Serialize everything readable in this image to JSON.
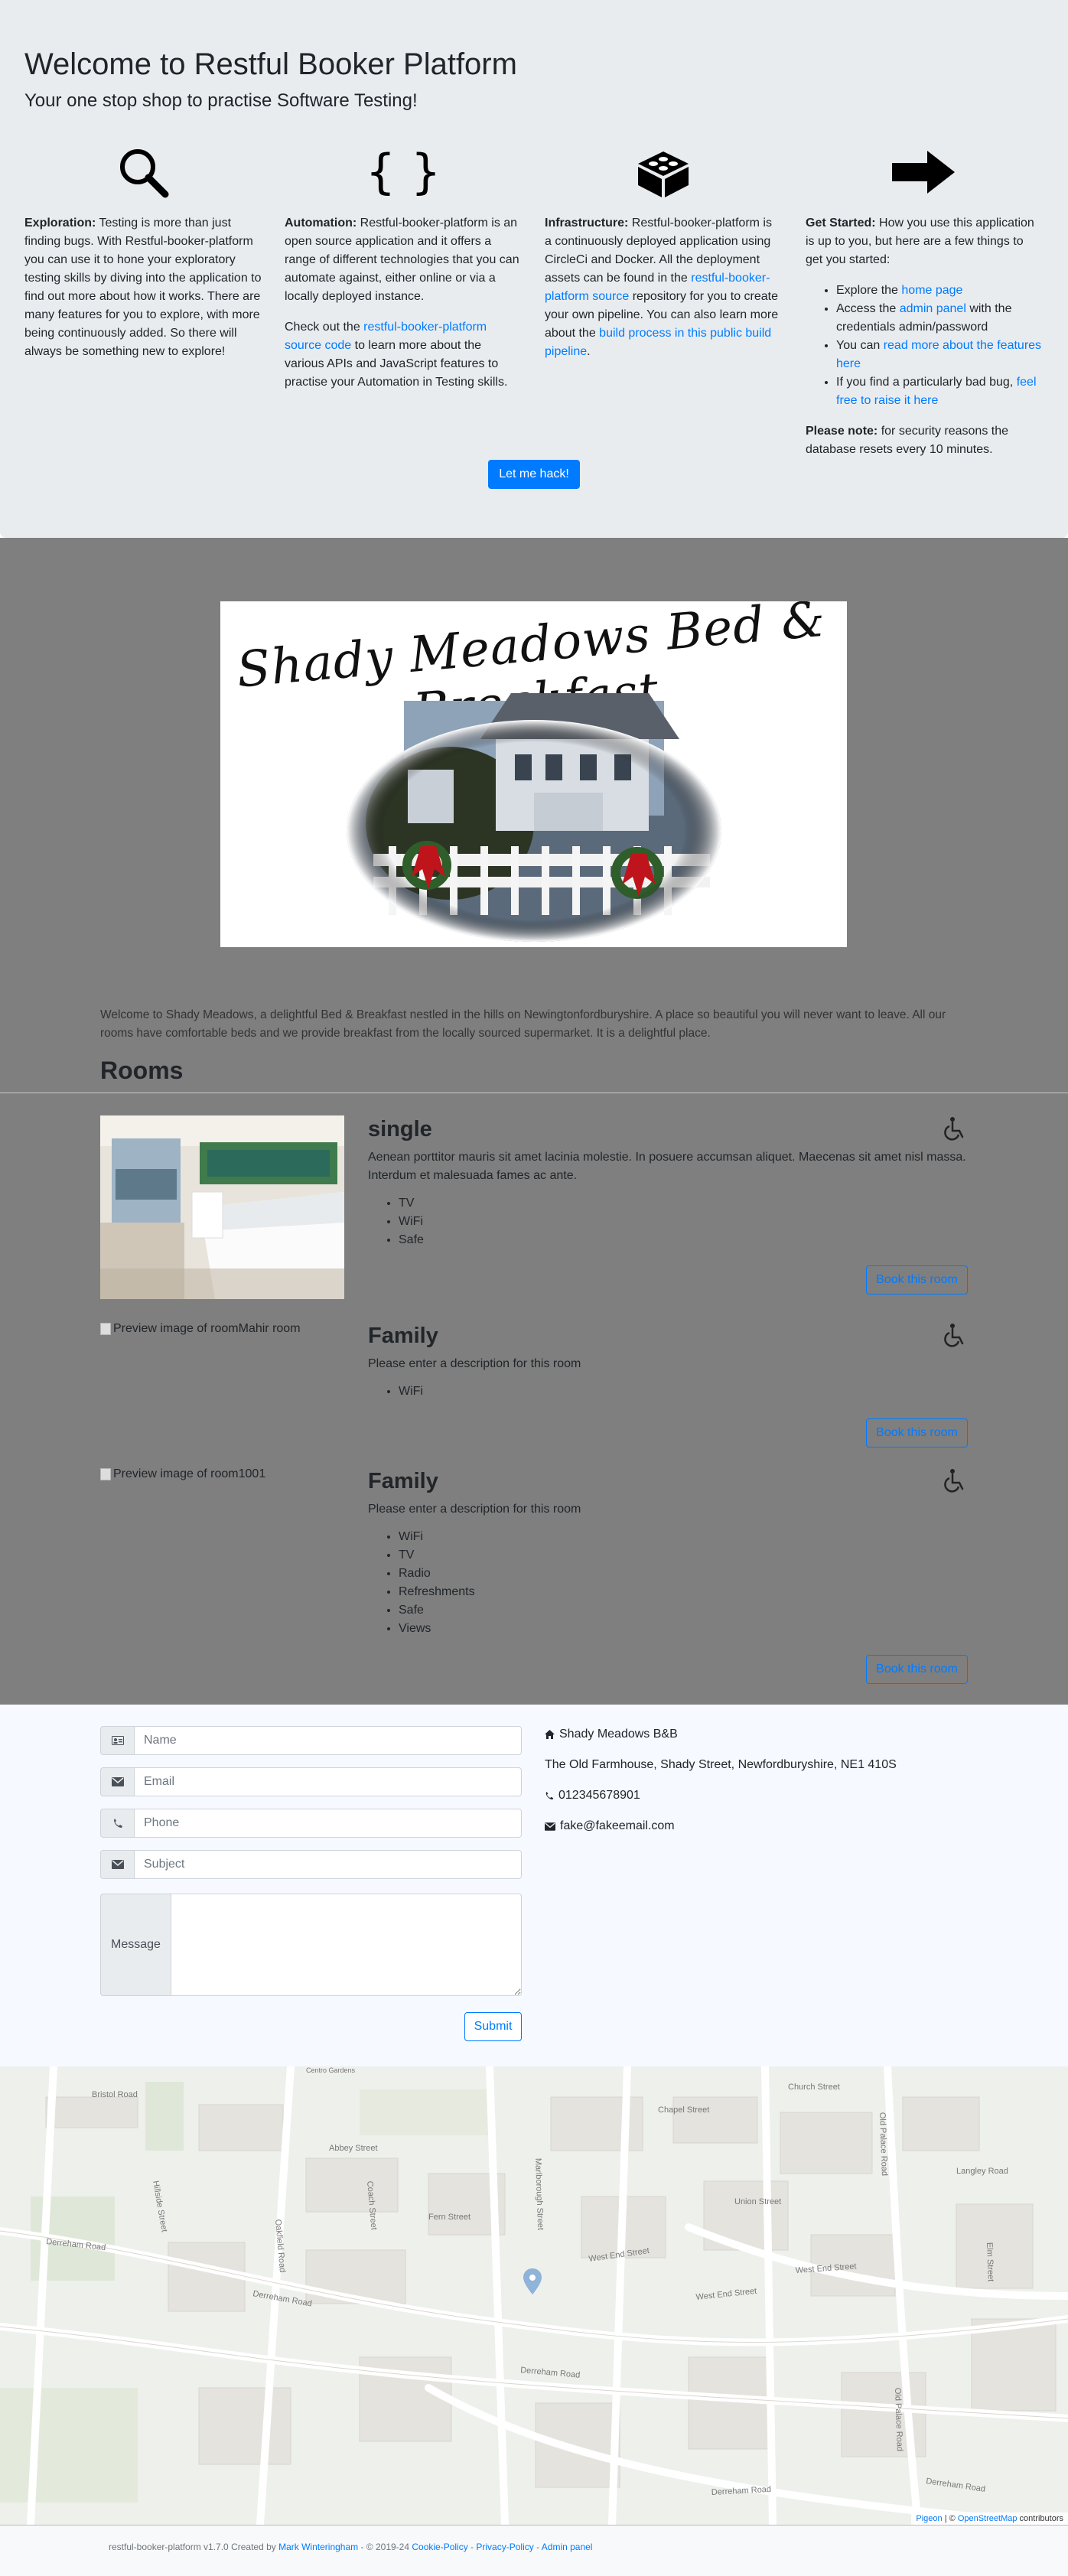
{
  "hero": {
    "title": "Welcome to Restful Booker Platform",
    "subtitle": "Your one stop shop to practise Software Testing!",
    "exploration": {
      "heading": "Exploration:",
      "text": " Testing is more than just finding bugs. With Restful-booker-platform you can use it to hone your exploratory testing skills by diving into the application to find out more about how it works. There are many features for you to explore, with more being continuously added. So there will always be something new to explore!"
    },
    "automation": {
      "heading": "Automation:",
      "text": " Restful-booker-platform is an open source application and it offers a range of different technologies that you can automate against, either online or via a locally deployed instance.",
      "p2_pre": "Check out the ",
      "p2_link": "restful-booker-platform source code",
      "p2_post": " to learn more about the various APIs and JavaScript features to practise your Automation in Testing skills."
    },
    "infrastructure": {
      "heading": "Infrastructure:",
      "text": " Restful-booker-platform is a continuously deployed application using CircleCi and Docker. All the deployment assets can be found in the ",
      "link1": "restful-booker-platform source",
      "mid": " repository for you to create your own pipeline. You can also learn more about the ",
      "link2": "build process in this public build pipeline",
      "end": "."
    },
    "get_started": {
      "heading": "Get Started:",
      "text": " How you use this application is up to you, but here are a few things to get you started:",
      "items": [
        {
          "pre": "Explore the ",
          "link": "home page",
          "post": ""
        },
        {
          "pre": "Access the ",
          "link": "admin panel",
          "post": " with the credentials admin/password"
        },
        {
          "pre": "You can ",
          "link": "read more about the features here",
          "post": ""
        },
        {
          "pre": "If you find a particularly bad bug, ",
          "link": "feel free to raise it here",
          "post": ""
        }
      ],
      "note_heading": "Please note:",
      "note": " for security reasons the database resets every 10 minutes."
    },
    "hack_button": "Let me hack!"
  },
  "banner": {
    "title": "Shady Meadows Bed & Breakfast"
  },
  "intro": "Welcome to Shady Meadows, a delightful Bed & Breakfast nestled in the hills on Newingtonfordburyshire. A place so beautiful you will never want to leave. All our rooms have comfortable beds and we provide breakfast from the locally sourced supermarket. It is a delightful place.",
  "rooms_heading": "Rooms",
  "rooms": [
    {
      "name": "single",
      "image_alt": "",
      "description": "Aenean porttitor mauris sit amet lacinia molestie. In posuere accumsan aliquet. Maecenas sit amet nisl massa. Interdum et malesuada fames ac ante.",
      "features": [
        "TV",
        "WiFi",
        "Safe"
      ],
      "book_label": "Book this room"
    },
    {
      "name": "Family",
      "image_alt": "Preview image of roomMahir room",
      "description": "Please enter a description for this room",
      "features": [
        "WiFi"
      ],
      "book_label": "Book this room"
    },
    {
      "name": "Family",
      "image_alt": "Preview image of room1001",
      "description": "Please enter a description for this room",
      "features": [
        "WiFi",
        "TV",
        "Radio",
        "Refreshments",
        "Safe",
        "Views"
      ],
      "book_label": "Book this room"
    }
  ],
  "contact_form": {
    "name_placeholder": "Name",
    "email_placeholder": "Email",
    "phone_placeholder": "Phone",
    "subject_placeholder": "Subject",
    "message_label": "Message",
    "submit_label": "Submit"
  },
  "contact_info": {
    "name": "Shady Meadows B&B",
    "address": "The Old Farmhouse, Shady Street, Newfordburyshire, NE1 410S",
    "phone": "012345678901",
    "email": "fake@fakeemail.com"
  },
  "map": {
    "attribution_pigeon": "Pigeon",
    "attribution_sep": " | © ",
    "attribution_osm": "OpenStreetMap",
    "attribution_end": " contributors",
    "streets": [
      "Derreham Road",
      "Derreham Road",
      "Derreham Road",
      "Derreham Road",
      "Derreham Road",
      "Oakfield Road",
      "West End Street",
      "West End Street",
      "West End Street",
      "Old Palace Road",
      "Old Palace Road",
      "Abbey Street",
      "Hillside Street",
      "Marlborough Street",
      "Langley Road",
      "Bristol Road",
      "Chapel Street",
      "Union Street",
      "Fern Street",
      "Coach Street",
      "Church Street",
      "Elm Street",
      "Centro Gardens"
    ]
  },
  "footer": {
    "pre": "restful-booker-platform v1.7.0 Created by ",
    "author": "Mark Winteringham",
    "mid": " - © 2019-24 ",
    "cookie": "Cookie-Policy",
    "sep1": " - ",
    "privacy": "Privacy-Policy",
    "sep2": " - ",
    "admin": "Admin panel"
  },
  "colors": {
    "primary": "#007bff",
    "hero_bg": "#e9ecef",
    "rooms_bg": "#7f7f7f",
    "contact_bg": "#f6f9ff"
  },
  "icons": [
    "search-icon",
    "curly-braces-icon",
    "cube-icon",
    "arrow-right-icon",
    "wheelchair-icon",
    "id-card-icon",
    "envelope-icon",
    "phone-icon",
    "home-icon",
    "map-pin-icon"
  ]
}
